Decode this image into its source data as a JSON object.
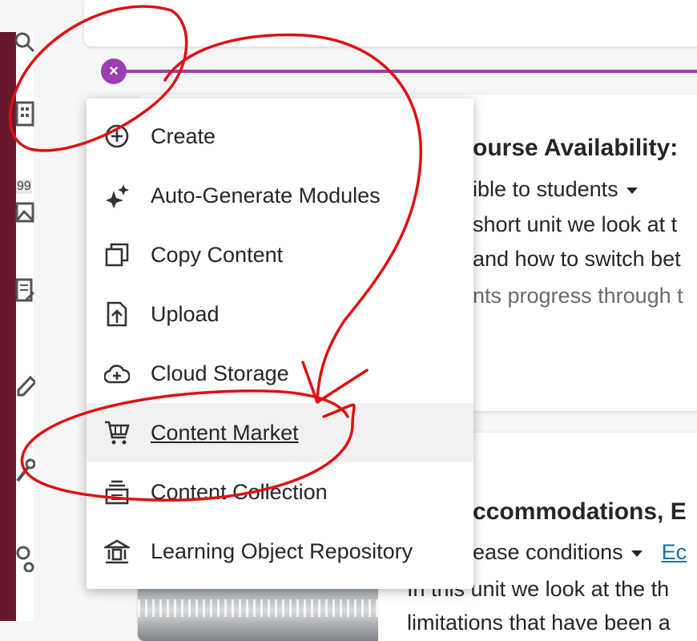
{
  "colors": {
    "accent_purple": "#9b3fb5",
    "left_rail": "#6a1830",
    "annotation_red": "#e01010",
    "link_blue": "#1a6fa8"
  },
  "strip": {
    "badge": "99"
  },
  "add_button": {
    "icon": "close-icon",
    "glyph": "×"
  },
  "menu": {
    "items": [
      {
        "label": "Create",
        "icon": "plus-circle-icon"
      },
      {
        "label": "Auto-Generate Modules",
        "icon": "sparkle-icon"
      },
      {
        "label": "Copy Content",
        "icon": "copy-icon"
      },
      {
        "label": "Upload",
        "icon": "upload-icon"
      },
      {
        "label": "Cloud Storage",
        "icon": "cloud-icon"
      },
      {
        "label": "Content Market",
        "icon": "cart-icon",
        "active": true
      },
      {
        "label": "Content Collection",
        "icon": "collection-icon"
      },
      {
        "label": "Learning Object Repository",
        "icon": "repository-icon"
      }
    ]
  },
  "module1": {
    "title": "ourse Availability:",
    "visibility": "ible to students",
    "line1": "short unit we look at t",
    "line2": "and how to switch bet",
    "line3": "nts progress through t"
  },
  "module2": {
    "title": "ccommodations, E",
    "release": "ease conditions",
    "edit": "Ec",
    "line1": "In this unit we look at the th",
    "line2": "limitations that have been a"
  }
}
